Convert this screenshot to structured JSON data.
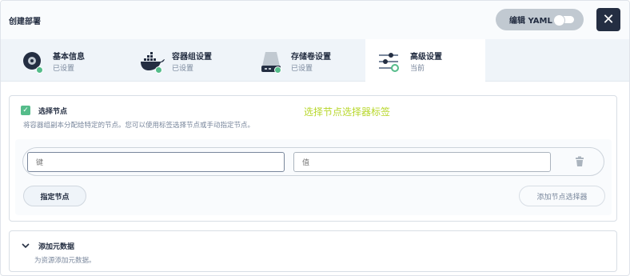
{
  "header": {
    "title": "创建部署",
    "yaml_label": "编辑 YAML",
    "close_label": "✕"
  },
  "tabs": [
    {
      "label": "基本信息",
      "sub": "已设置",
      "icon": "disc-icon",
      "status": "done"
    },
    {
      "label": "容器组设置",
      "sub": "已设置",
      "icon": "docker-icon",
      "status": "done"
    },
    {
      "label": "存储卷设置",
      "sub": "已设置",
      "icon": "storage-icon",
      "status": "done"
    },
    {
      "label": "高级设置",
      "sub": "当前",
      "icon": "sliders-icon",
      "status": "current"
    }
  ],
  "node_selector": {
    "checkbox_checked": true,
    "title": "选择节点",
    "annotation": "选择节点选择器标签",
    "description": "将容器组副本分配给特定的节点。您可以使用标签选择节点或手动指定节点。",
    "key_placeholder": "键",
    "value_placeholder": "值",
    "assign_label": "指定节点",
    "add_label": "添加节点选择器"
  },
  "metadata": {
    "title": "添加元数据",
    "description": "为资源添加元数据。"
  },
  "colors": {
    "accent_green": "#55bc8a",
    "dark": "#242e42",
    "annotation": "#b8d72c"
  }
}
